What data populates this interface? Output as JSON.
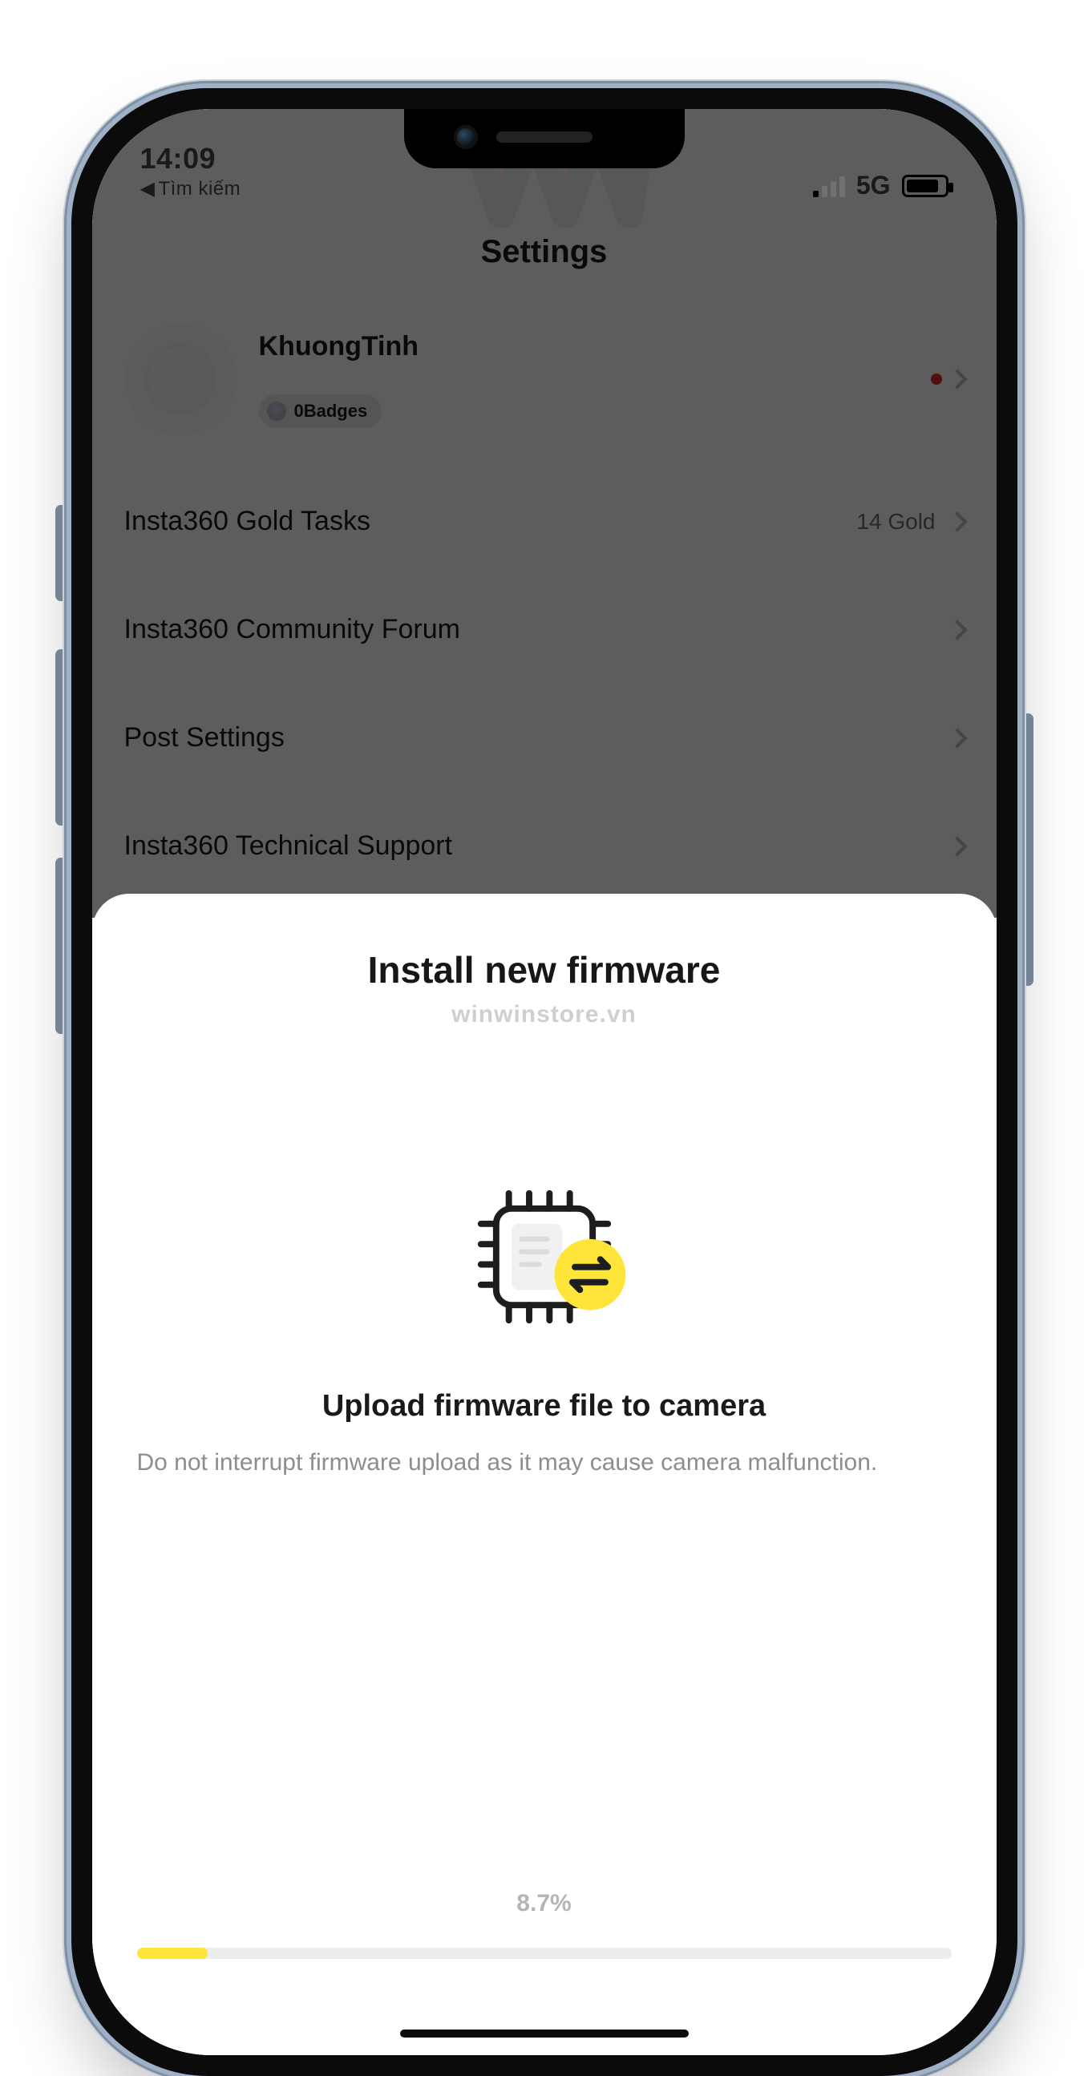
{
  "status_bar": {
    "time": "14:09",
    "back_label": "Tìm kiếm",
    "network": "5G"
  },
  "settings": {
    "title": "Settings",
    "profile": {
      "name": "KhuongTinh",
      "badges_label": "0Badges"
    },
    "items": [
      {
        "label": "Insta360 Gold Tasks",
        "value": "14 Gold"
      },
      {
        "label": "Insta360 Community Forum",
        "value": ""
      },
      {
        "label": "Post Settings",
        "value": ""
      },
      {
        "label": "Insta360 Technical Support",
        "value": ""
      }
    ]
  },
  "modal": {
    "title": "Install new firmware",
    "watermark": "winwinstore.vn",
    "upload_title": "Upload firmware file to camera",
    "upload_desc": "Do not interrupt firmware upload as it may cause camera malfunction.",
    "progress_label": "8.7%",
    "progress_percent": 8.7
  }
}
